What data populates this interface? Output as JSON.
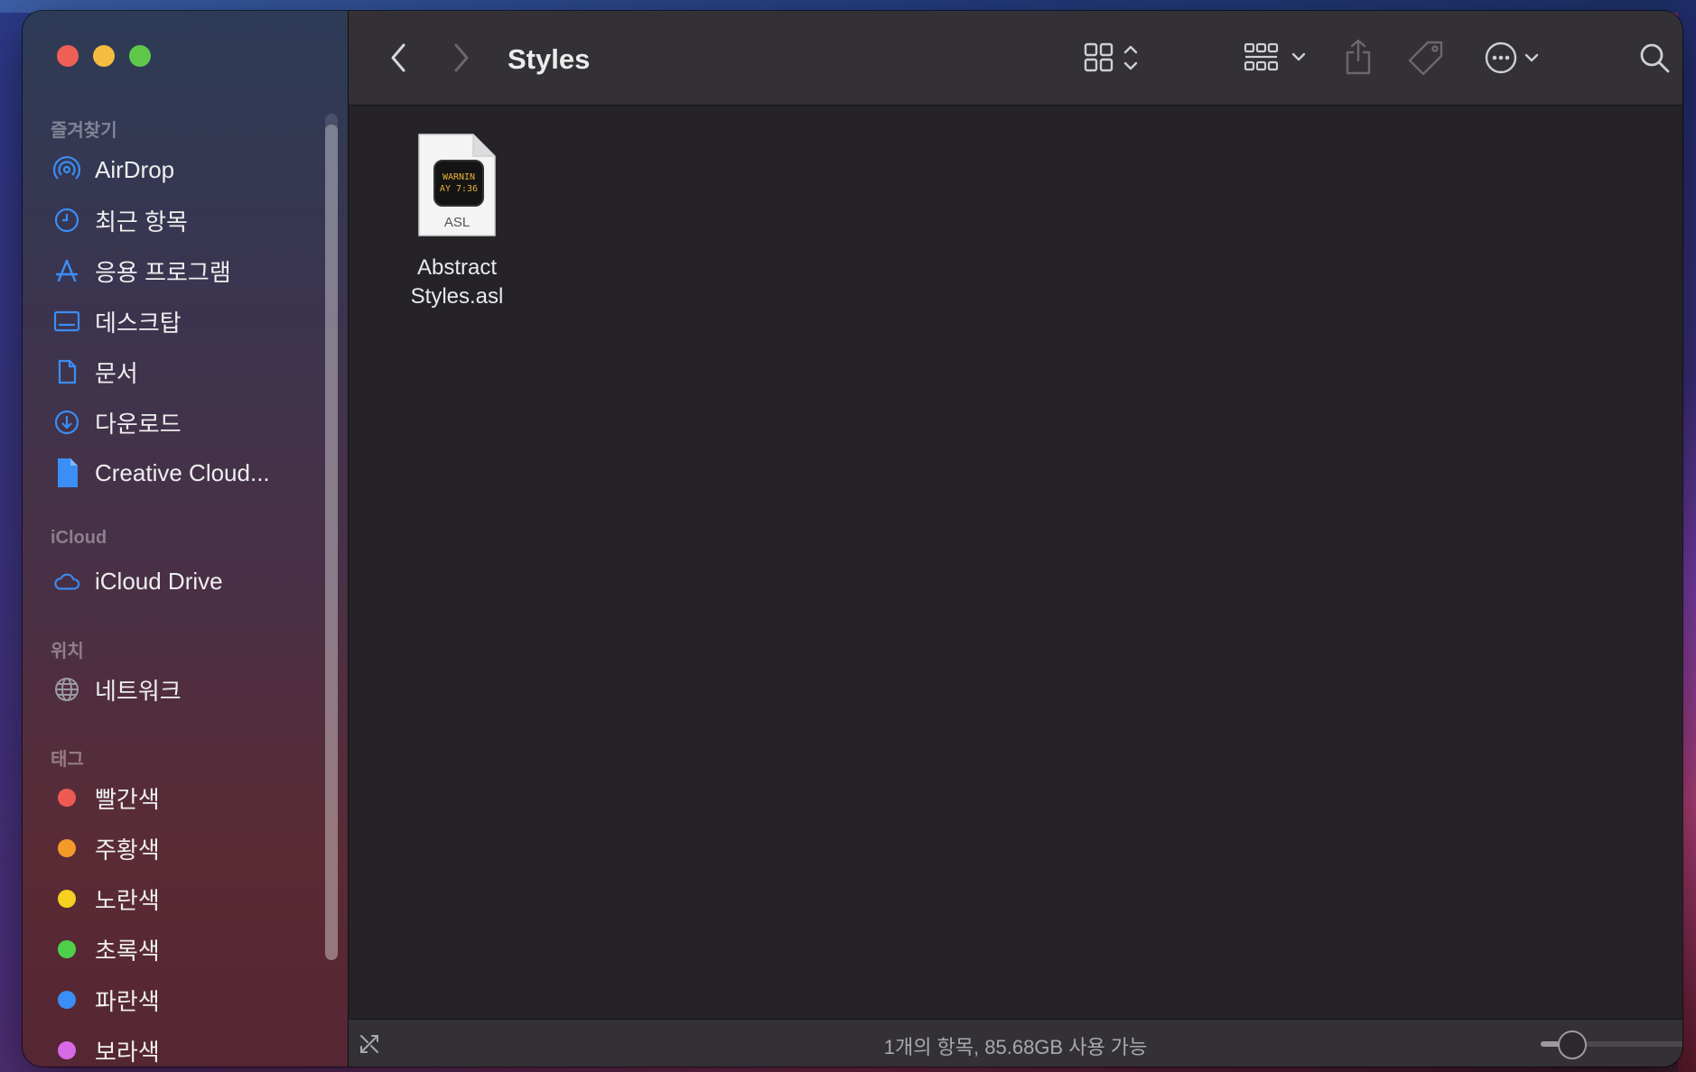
{
  "window": {
    "title": "Styles"
  },
  "sidebar": {
    "sections": {
      "favorites": "즐겨찾기",
      "icloud": "iCloud",
      "locations": "위치",
      "tags": "태그"
    },
    "favorites": [
      {
        "label": "AirDrop",
        "icon": "airdrop-icon"
      },
      {
        "label": "최근 항목",
        "icon": "clock-icon"
      },
      {
        "label": "응용 프로그램",
        "icon": "applications-icon"
      },
      {
        "label": "데스크탑",
        "icon": "desktop-icon"
      },
      {
        "label": "문서",
        "icon": "document-icon"
      },
      {
        "label": "다운로드",
        "icon": "download-icon"
      },
      {
        "label": "Creative Cloud...",
        "icon": "file-icon"
      }
    ],
    "icloud": [
      {
        "label": "iCloud Drive",
        "icon": "cloud-icon"
      }
    ],
    "locations": [
      {
        "label": "네트워크",
        "icon": "globe-icon"
      }
    ],
    "tags": [
      {
        "label": "빨간색",
        "color": "#ee5a52"
      },
      {
        "label": "주황색",
        "color": "#f39a2b"
      },
      {
        "label": "노란색",
        "color": "#f5d020"
      },
      {
        "label": "초록색",
        "color": "#4fd04a"
      },
      {
        "label": "파란색",
        "color": "#3a8ef5"
      },
      {
        "label": "보라색",
        "color": "#d86ae8"
      }
    ]
  },
  "files": [
    {
      "name_line1": "Abstract",
      "name_line2": "Styles.asl",
      "badge": "ASL",
      "screen_line1": "WARNIN",
      "screen_line2": "AY 7:36"
    }
  ],
  "status": {
    "text": "1개의 항목, 85.68GB 사용 가능",
    "icon_zoom_fraction": 0.22
  },
  "colors": {
    "accent": "#3a8ef5"
  }
}
